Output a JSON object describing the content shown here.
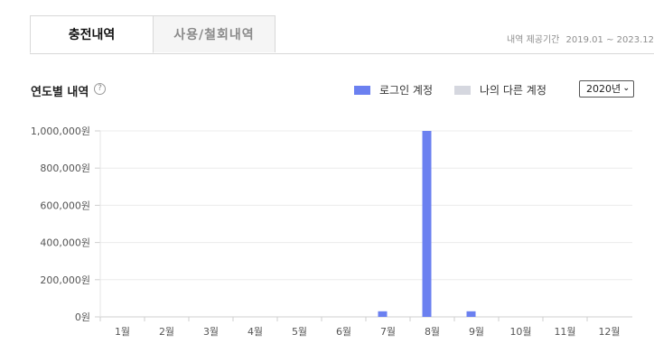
{
  "tabs": [
    {
      "label": "충전내역",
      "active": true
    },
    {
      "label": "사용/철회내역",
      "active": false
    }
  ],
  "period": {
    "label": "내역 제공기간",
    "range": "2019.01 ~ 2023.12"
  },
  "section": {
    "title": "연도별 내역",
    "help_icon": "question-circle-icon"
  },
  "legend": [
    {
      "label": "로그인 계정",
      "color": "#6b80f0"
    },
    {
      "label": "나의 다른 계정",
      "color": "#d5d7df"
    }
  ],
  "year_select": {
    "selected": "2020년"
  },
  "chart_data": {
    "type": "bar",
    "categories": [
      "1월",
      "2월",
      "3월",
      "4월",
      "5월",
      "6월",
      "7월",
      "8월",
      "9월",
      "10월",
      "11월",
      "12월"
    ],
    "series": [
      {
        "name": "로그인 계정",
        "color": "#6b80f0",
        "values": [
          0,
          0,
          0,
          0,
          0,
          0,
          30000,
          1000000,
          30000,
          0,
          0,
          0
        ]
      },
      {
        "name": "나의 다른 계정",
        "color": "#d5d7df",
        "values": [
          0,
          0,
          0,
          0,
          0,
          0,
          0,
          0,
          0,
          0,
          0,
          0
        ]
      }
    ],
    "y_ticks": [
      "0원",
      "200,000원",
      "400,000원",
      "600,000원",
      "800,000원",
      "1,000,000원"
    ],
    "ylim": [
      0,
      1000000
    ],
    "grid": true
  }
}
